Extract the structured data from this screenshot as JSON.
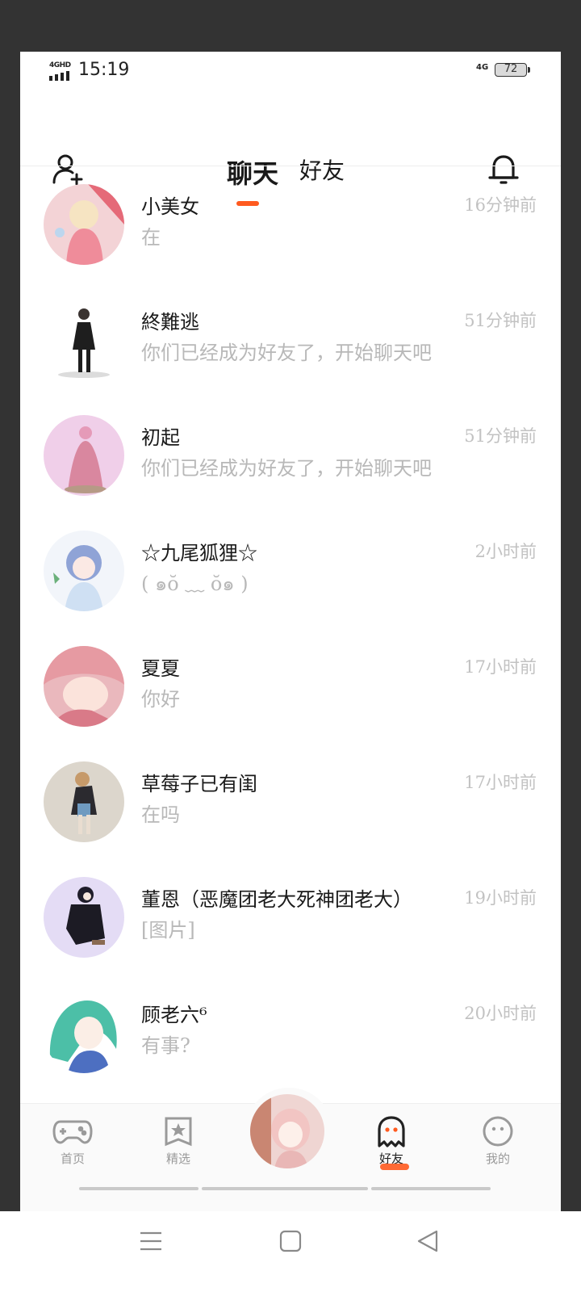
{
  "status_bar": {
    "network_type": "4GHD",
    "time": "15:19",
    "network_type_right": "4G",
    "battery_level": "72"
  },
  "header": {
    "add_friend_icon": "add-user-icon",
    "tabs": [
      {
        "label": "聊天",
        "active": true
      },
      {
        "label": "好友",
        "active": false
      }
    ],
    "notification_icon": "bell-icon",
    "accent_color": "#ff5a1f"
  },
  "chats": [
    {
      "name": "小美女",
      "message": "在",
      "time": "16分钟前"
    },
    {
      "name": "終難逃",
      "message": "你们已经成为好友了，开始聊天吧",
      "time": "51分钟前"
    },
    {
      "name": "初起",
      "message": "你们已经成为好友了，开始聊天吧",
      "time": "51分钟前"
    },
    {
      "name": "☆九尾狐狸☆",
      "message": "( ๑ŏ ﹏ ŏ๑ )",
      "time": "2小时前"
    },
    {
      "name": "夏夏",
      "message": "你好",
      "time": "17小时前"
    },
    {
      "name": "草莓子已有闺",
      "message": "在吗",
      "time": "17小时前"
    },
    {
      "name": "董恩（恶魔团老大死神团老大）",
      "message": "[图片]",
      "time": "19小时前"
    },
    {
      "name": "顾老六⁶",
      "message": "有事?",
      "time": "20小时前"
    }
  ],
  "bottom_nav": {
    "items": [
      {
        "label": "首页",
        "icon": "gamepad-icon",
        "active": false
      },
      {
        "label": "精选",
        "icon": "star-badge-icon",
        "active": false
      },
      {
        "label": "好友",
        "icon": "ghost-icon",
        "active": true
      },
      {
        "label": "我的",
        "icon": "face-icon",
        "active": false
      }
    ]
  },
  "system_nav": {
    "icons": [
      "menu-icon",
      "home-square-icon",
      "back-triangle-icon"
    ]
  }
}
